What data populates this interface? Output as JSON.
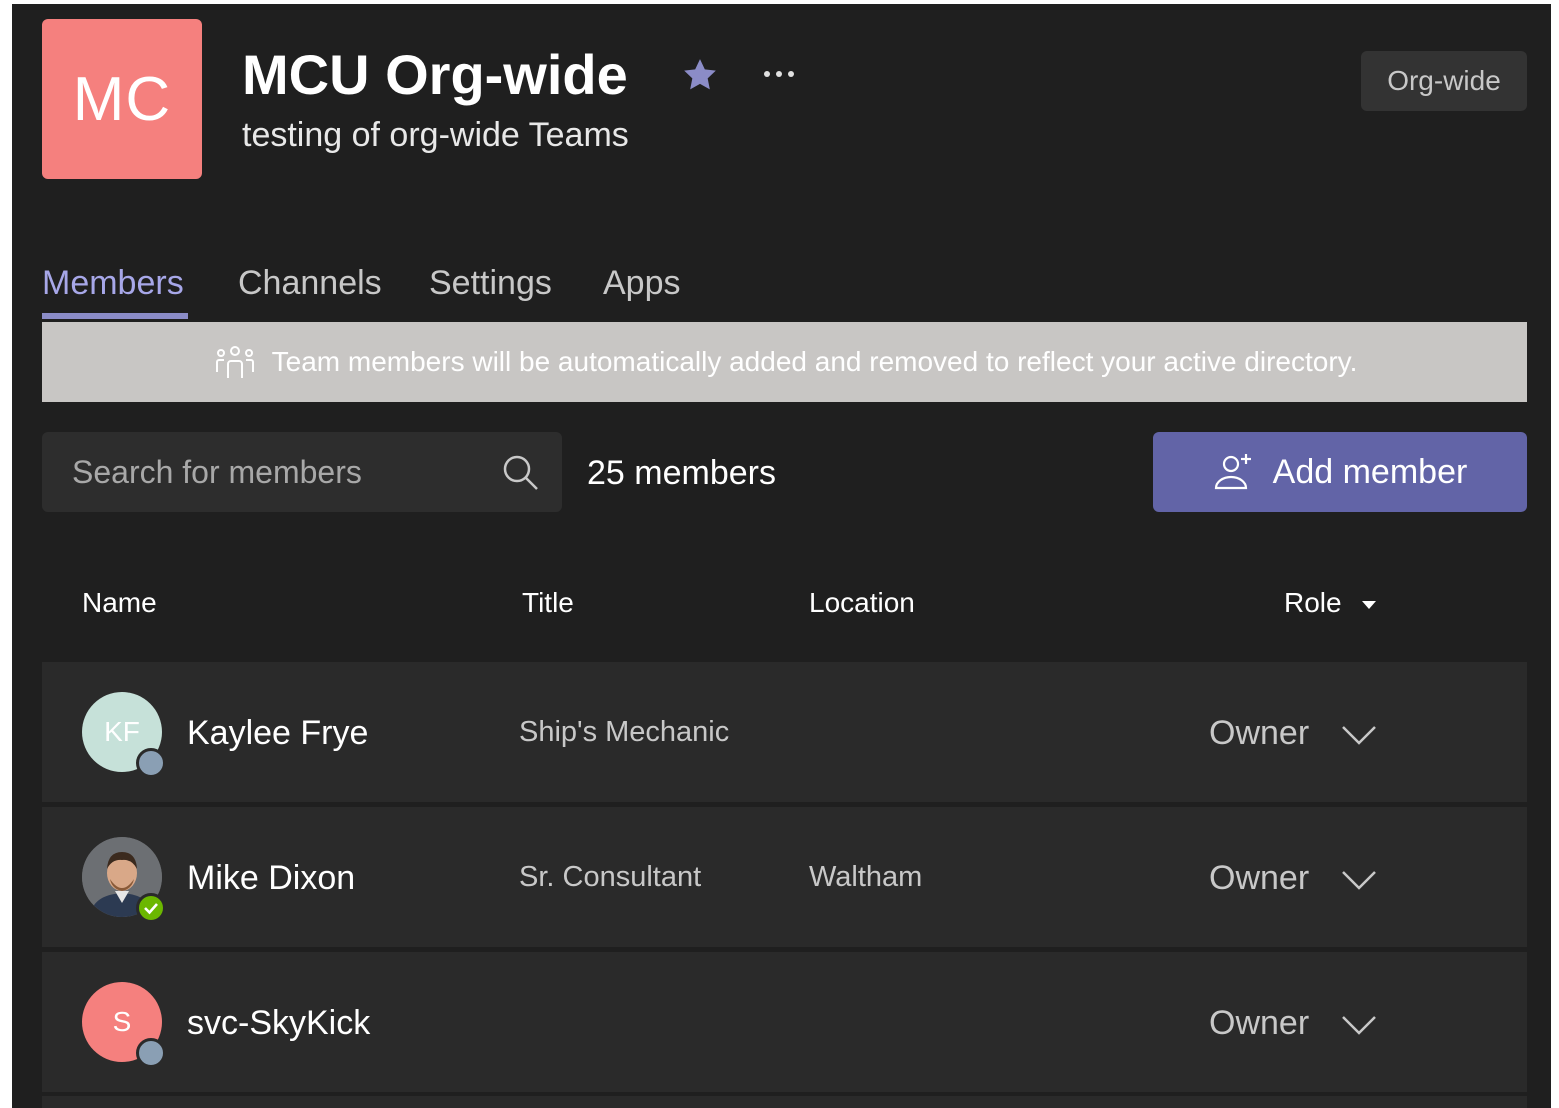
{
  "team": {
    "initials": "MC",
    "name": "MCU Org-wide",
    "description": "testing of org-wide Teams",
    "badge": "Org-wide",
    "avatar_color": "#f5807e"
  },
  "tabs": [
    {
      "label": "Members",
      "active": true
    },
    {
      "label": "Channels",
      "active": false
    },
    {
      "label": "Settings",
      "active": false
    },
    {
      "label": "Apps",
      "active": false
    }
  ],
  "banner": {
    "icon": "people-group-icon",
    "text": "Team members will be automatically added and removed to reflect your active directory."
  },
  "search": {
    "placeholder": "Search for members",
    "value": ""
  },
  "member_count": "25 members",
  "add_member": {
    "label": "Add member",
    "icon": "add-user-icon"
  },
  "columns": {
    "name": "Name",
    "title": "Title",
    "location": "Location",
    "role": "Role"
  },
  "members": [
    {
      "initials": "KF",
      "name": "Kaylee Frye",
      "title": "Ship's Mechanic",
      "location": "",
      "role": "Owner",
      "avatar_color": "#c6e1d9",
      "presence": "offline"
    },
    {
      "initials": "",
      "name": "Mike Dixon",
      "title": "Sr. Consultant",
      "location": "Waltham",
      "role": "Owner",
      "avatar_color": "#5a5a5a",
      "presence": "available",
      "photo": true
    },
    {
      "initials": "S",
      "name": "svc-SkyKick",
      "title": "",
      "location": "",
      "role": "Owner",
      "avatar_color": "#f5807e",
      "presence": "offline"
    }
  ],
  "colors": {
    "accent": "#6264a7",
    "active_tab": "#a7a7e8",
    "presence_available": "#6bb700",
    "presence_offline": "#8a9fb4"
  }
}
